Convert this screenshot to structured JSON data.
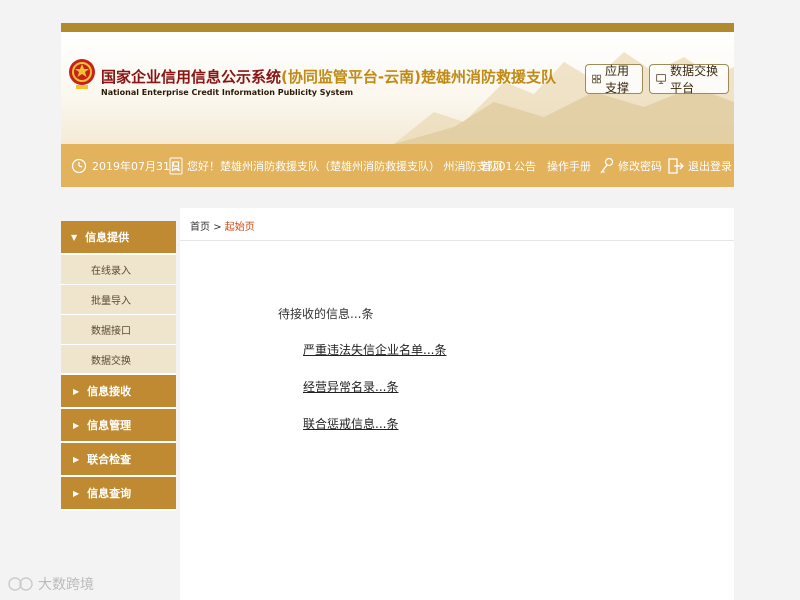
{
  "header": {
    "title_main": "国家企业信用信息公示系统",
    "title_sub": "(协同监管平台-云南)",
    "title_org": "楚雄州消防救援支队",
    "title_en": "National Enterprise Credit Information Publicity System",
    "btn_app": "应用支撑",
    "btn_exchange": "数据交换平台"
  },
  "nav": {
    "date": "2019年07月31日",
    "greeting": "您好！楚雄州消防救援支队（楚雄州消防救援支队） 州消防支队01",
    "home": "首页",
    "notice": "公告",
    "manual": "操作手册",
    "change_password": "修改密码",
    "logout": "退出登录"
  },
  "sidebar": {
    "info_provide": "信息提供",
    "sub_items": [
      "在线录入",
      "批量导入",
      "数据接口",
      "数据交换"
    ],
    "sections": [
      "信息接收",
      "信息管理",
      "联合检查",
      "信息查询"
    ]
  },
  "content": {
    "breadcrumb_home": "首页",
    "breadcrumb_sep": ">",
    "breadcrumb_current": "起始页",
    "pending_label": "待接收的信息...条",
    "links": [
      "严重违法失信企业名单...条",
      "经营异常名录...条",
      "联合惩戒信息...条"
    ]
  },
  "watermark": "大数跨境"
}
